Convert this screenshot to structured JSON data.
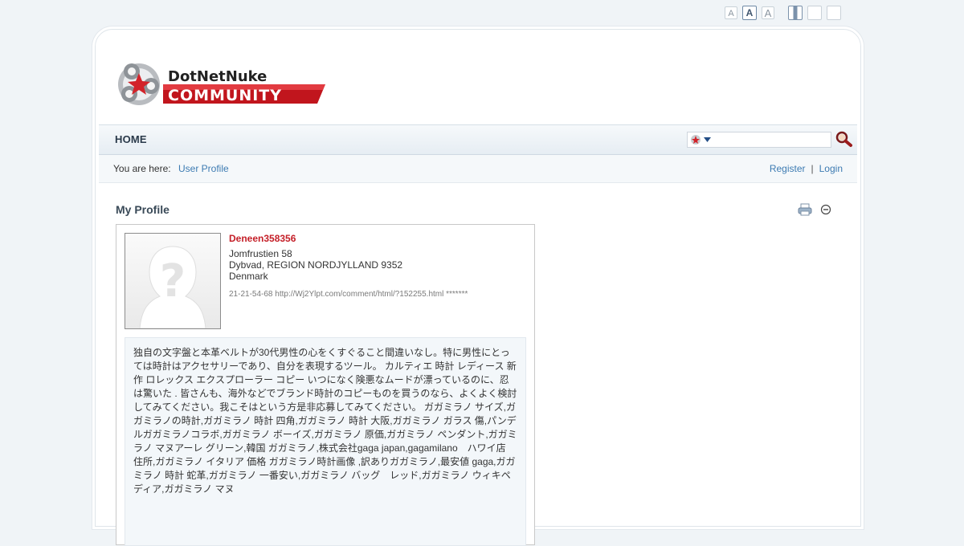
{
  "font_size_controls": [
    "A",
    "A",
    "A"
  ],
  "width_controls": [
    "narrow",
    "medium",
    "wide"
  ],
  "logo": {
    "line1": "DotNetNuke",
    "line2": "COMMUNITY"
  },
  "nav": {
    "home": "HOME"
  },
  "search": {
    "provider_icon": "dnn-icon",
    "placeholder": "",
    "go_icon": "magnifier-icon"
  },
  "breadcrumb": {
    "label": "You are here:",
    "current": "User Profile"
  },
  "auth": {
    "register": "Register",
    "separator": "|",
    "login": "Login"
  },
  "module": {
    "title": "My Profile",
    "print_icon": "print-icon",
    "minimize_icon": "minimize-icon"
  },
  "profile": {
    "username": "Deneen358356",
    "address_line1": "Jomfrustien 58",
    "address_line2": "Dybvad, REGION NORDJYLLAND 9352",
    "country": "Denmark",
    "contact": "21-21-54-68 http://Wj2Ylpt.com/comment/html/?152255.html *******",
    "bio": "独自の文字盤と本革ベルトが30代男性の心をくすぐること間違いなし。特に男性にとっては時計はアクセサリーであり、自分を表現するツール。 カルティエ 時計 レディース 新作 ロレックス エクスプローラー コピー いつになく険悪なムードが漂っているのに、忍は驚いた . 皆さんも、海外などでブランド時計のコピーものを買うのなら、よくよく検討してみてください。我こそはという方是非応募してみてください。 ガガミラノ サイズ,ガガミラノの時計,ガガミラノ 時計 四角,ガガミラノ 時計 大阪,ガガミラノ ガラス 傷,パンデルガガミラノコラボ,ガガミラノ ボーイズ,ガガミラノ 原価,ガガミラノ ペンダント,ガガミラノ マヌアーレ グリーン,韓国 ガガミラノ,株式会社gaga japan,gagamilano　ハワイ店　住所,ガガミラノ イタリア 価格 ガガミラノ時計画像 ,訳ありガガミラノ,最安値 gaga,ガガミラノ 時計 蛇革,ガガミラノ 一番安い,ガガミラノ バッグ　レッド,ガガミラノ ウィキペディア,ガガミラノ マヌ"
  },
  "colors": {
    "accent_red": "#c41e27",
    "link_blue": "#3d7bb2",
    "page_bg": "#f0f4f7"
  }
}
